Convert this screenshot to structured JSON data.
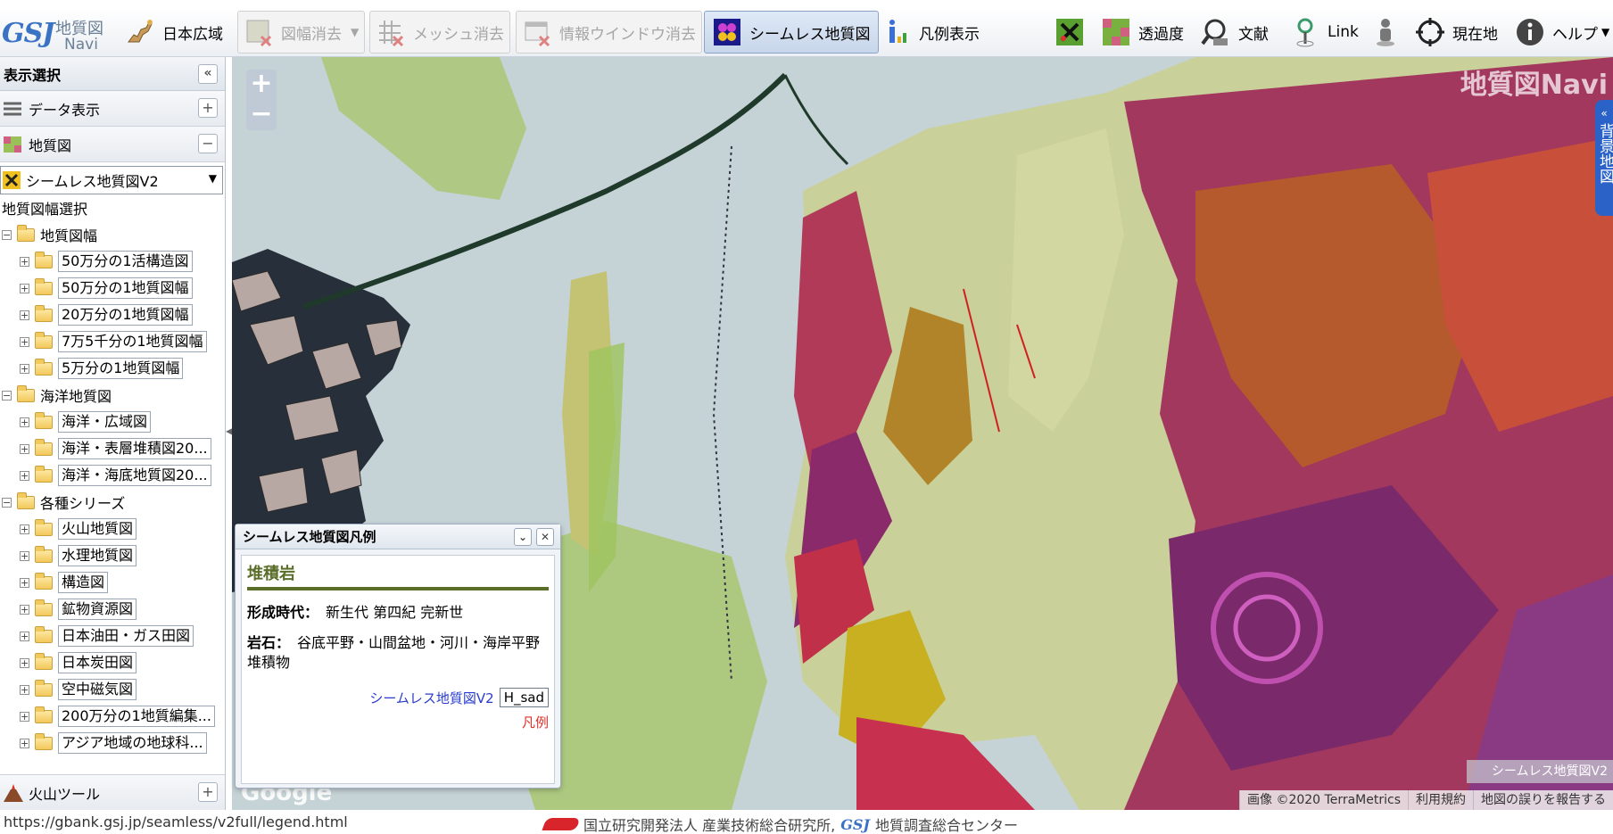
{
  "toolbar": {
    "logo_text": "GSJ",
    "logo_line1": "地質図",
    "logo_line2": "Navi",
    "btn_wide_area": "日本広域",
    "btn_clear_sheet": "図幅消去",
    "btn_clear_mesh": "メッシュ消去",
    "btn_clear_info": "情報ウインドウ消去",
    "btn_seamless": "シームレス地質図",
    "btn_legend": "凡例表示",
    "btn_transparency": "透過度",
    "btn_literature": "文献",
    "btn_link": "Link",
    "btn_current_location": "現在地",
    "btn_help": "ヘルプ"
  },
  "sidebar": {
    "header": "表示選択",
    "data_display": "データ表示",
    "geology_map": "地質図",
    "selected_layer": "シームレス地質図V2",
    "tree_title": "地質図幅選択",
    "groups": [
      {
        "label": "地質図幅",
        "children": [
          "50万分の1活構造図",
          "50万分の1地質図幅",
          "20万分の1地質図幅",
          "7万5千分の1地質図幅",
          "5万分の1地質図幅"
        ]
      },
      {
        "label": "海洋地質図",
        "children": [
          "海洋・広域図",
          "海洋・表層堆積図20...",
          "海洋・海底地質図20..."
        ]
      },
      {
        "label": "各種シリーズ",
        "children": [
          "火山地質図",
          "水理地質図",
          "構造図",
          "鉱物資源図",
          "日本油田・ガス田図",
          "日本炭田図",
          "空中磁気図",
          "200万分の1地質編集...",
          "アジア地域の地球科..."
        ]
      }
    ],
    "volcano_tools": "火山ツール"
  },
  "map": {
    "watermark": "地質図Navi",
    "bg_map_tab": "背景地図",
    "layer_badge": "シームレス地質図V2",
    "google": "Google",
    "footer": [
      "画像 ©2020 TerraMetrics",
      "利用規約",
      "地図の誤りを報告する"
    ]
  },
  "legend_window": {
    "title": "シームレス地質図凡例",
    "rock_type": "堆積岩",
    "era_label": "形成時代：",
    "era_value": "新生代 第四紀 完新世",
    "rock_label": "岩石：",
    "rock_value": "谷底平野・山間盆地・河川・海岸平野堆積物",
    "source_link": "シームレス地質図V2",
    "code": "H_sad",
    "legend_link": "凡例"
  },
  "statusbar": {
    "url": "https://gbank.gsj.jp/seamless/v2full/legend.html",
    "org1": "国立研究開発法人 産業技術総合研究所,",
    "org_logo": "GSJ",
    "org2": "地質調査総合センター"
  }
}
